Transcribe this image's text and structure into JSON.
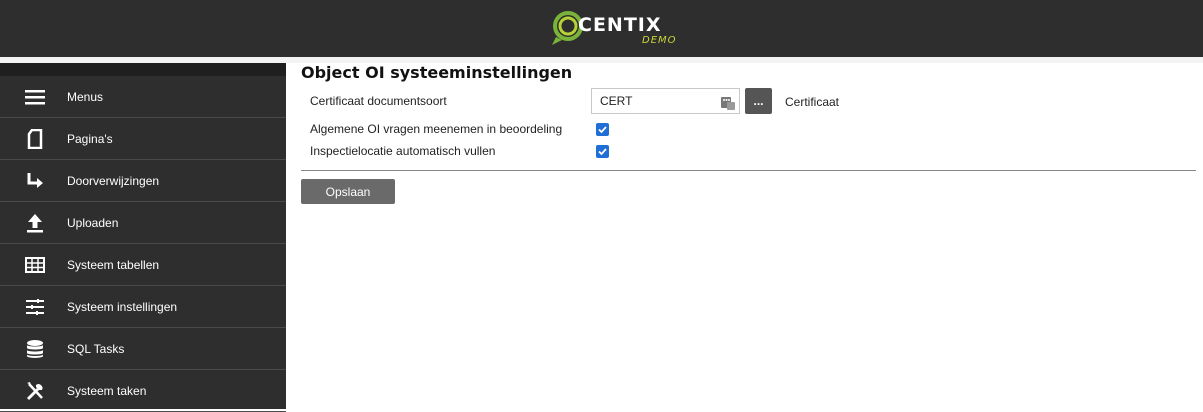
{
  "header": {
    "logo_text": "CENTIX",
    "logo_sub": "DEMO"
  },
  "sidebar": {
    "items": [
      {
        "label": "Menus",
        "icon": "hamburger-icon"
      },
      {
        "label": "Pagina's",
        "icon": "page-icon"
      },
      {
        "label": "Doorverwijzingen",
        "icon": "redirect-arrow-icon"
      },
      {
        "label": "Uploaden",
        "icon": "upload-icon"
      },
      {
        "label": "Systeem tabellen",
        "icon": "table-icon"
      },
      {
        "label": "Systeem instellingen",
        "icon": "sliders-icon"
      },
      {
        "label": "SQL Tasks",
        "icon": "database-icon"
      },
      {
        "label": "Systeem taken",
        "icon": "tools-icon"
      }
    ]
  },
  "main": {
    "title": "Object OI systeeminstellingen",
    "fields": {
      "cert_label": "Certificaat documentsoort",
      "cert_value": "CERT",
      "cert_lookup_label": "...",
      "cert_description": "Certificaat",
      "algemene_label": "Algemene OI vragen meenemen in beoordeling",
      "algemene_checked": true,
      "inspectie_label": "Inspectielocatie automatisch vullen",
      "inspectie_checked": true
    },
    "save_label": "Opslaan"
  },
  "colors": {
    "header_bg": "#2e2e2e",
    "sidebar_bg": "#2e2e2e",
    "checkbox": "#1f6fd6",
    "button": "#6a6a6a",
    "logo_accent": "#c8d63a"
  }
}
